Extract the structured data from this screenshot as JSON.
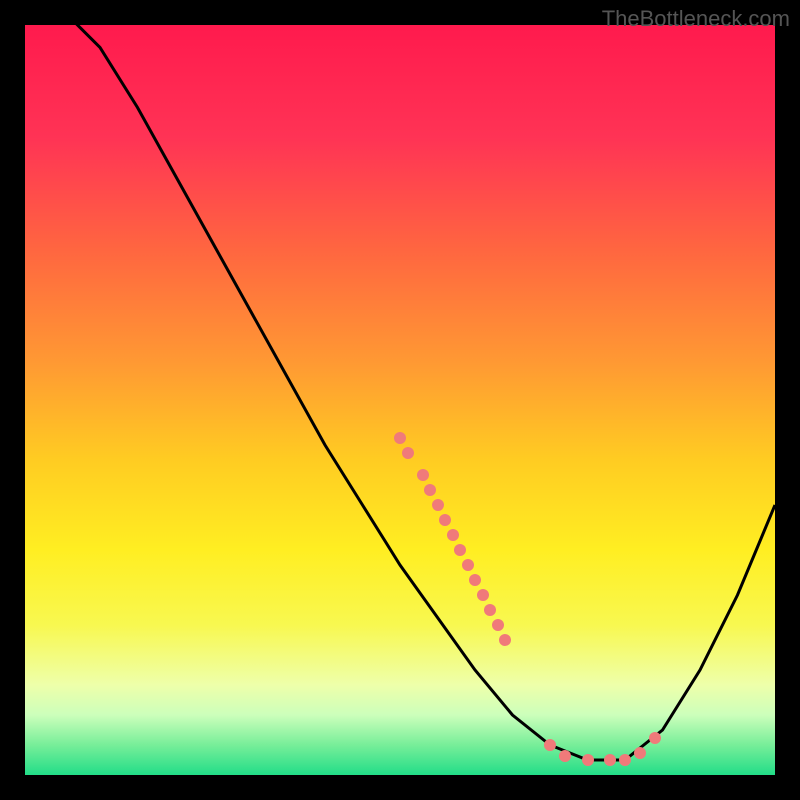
{
  "watermark": "TheBottleneck.com",
  "chart_data": {
    "type": "line",
    "title": "",
    "xlabel": "",
    "ylabel": "",
    "xlim": [
      0,
      100
    ],
    "ylim": [
      0,
      100
    ],
    "grid": false,
    "curve": [
      {
        "x": 0,
        "y": 105
      },
      {
        "x": 5,
        "y": 102
      },
      {
        "x": 10,
        "y": 97
      },
      {
        "x": 15,
        "y": 89
      },
      {
        "x": 20,
        "y": 80
      },
      {
        "x": 25,
        "y": 71
      },
      {
        "x": 30,
        "y": 62
      },
      {
        "x": 35,
        "y": 53
      },
      {
        "x": 40,
        "y": 44
      },
      {
        "x": 45,
        "y": 36
      },
      {
        "x": 50,
        "y": 28
      },
      {
        "x": 55,
        "y": 21
      },
      {
        "x": 60,
        "y": 14
      },
      {
        "x": 65,
        "y": 8
      },
      {
        "x": 70,
        "y": 4
      },
      {
        "x": 75,
        "y": 2
      },
      {
        "x": 80,
        "y": 2
      },
      {
        "x": 85,
        "y": 6
      },
      {
        "x": 90,
        "y": 14
      },
      {
        "x": 95,
        "y": 24
      },
      {
        "x": 100,
        "y": 36
      }
    ],
    "points": [
      {
        "x": 50,
        "y": 45
      },
      {
        "x": 51,
        "y": 43
      },
      {
        "x": 53,
        "y": 40
      },
      {
        "x": 54,
        "y": 38
      },
      {
        "x": 55,
        "y": 36
      },
      {
        "x": 56,
        "y": 34
      },
      {
        "x": 57,
        "y": 32
      },
      {
        "x": 58,
        "y": 30
      },
      {
        "x": 59,
        "y": 28
      },
      {
        "x": 60,
        "y": 26
      },
      {
        "x": 61,
        "y": 24
      },
      {
        "x": 62,
        "y": 22
      },
      {
        "x": 63,
        "y": 20
      },
      {
        "x": 64,
        "y": 18
      },
      {
        "x": 70,
        "y": 4
      },
      {
        "x": 72,
        "y": 2.5
      },
      {
        "x": 75,
        "y": 2
      },
      {
        "x": 78,
        "y": 2
      },
      {
        "x": 80,
        "y": 2
      },
      {
        "x": 82,
        "y": 3
      },
      {
        "x": 84,
        "y": 5
      }
    ],
    "gradient_stops": [
      {
        "offset": 0.0,
        "color": "#ff1a4d"
      },
      {
        "offset": 0.15,
        "color": "#ff3355"
      },
      {
        "offset": 0.3,
        "color": "#ff6640"
      },
      {
        "offset": 0.45,
        "color": "#ff9933"
      },
      {
        "offset": 0.58,
        "color": "#ffcc22"
      },
      {
        "offset": 0.7,
        "color": "#ffee22"
      },
      {
        "offset": 0.8,
        "color": "#f8f850"
      },
      {
        "offset": 0.88,
        "color": "#eeffaa"
      },
      {
        "offset": 0.92,
        "color": "#ccffbb"
      },
      {
        "offset": 0.96,
        "color": "#77ee99"
      },
      {
        "offset": 1.0,
        "color": "#22dd88"
      }
    ]
  }
}
